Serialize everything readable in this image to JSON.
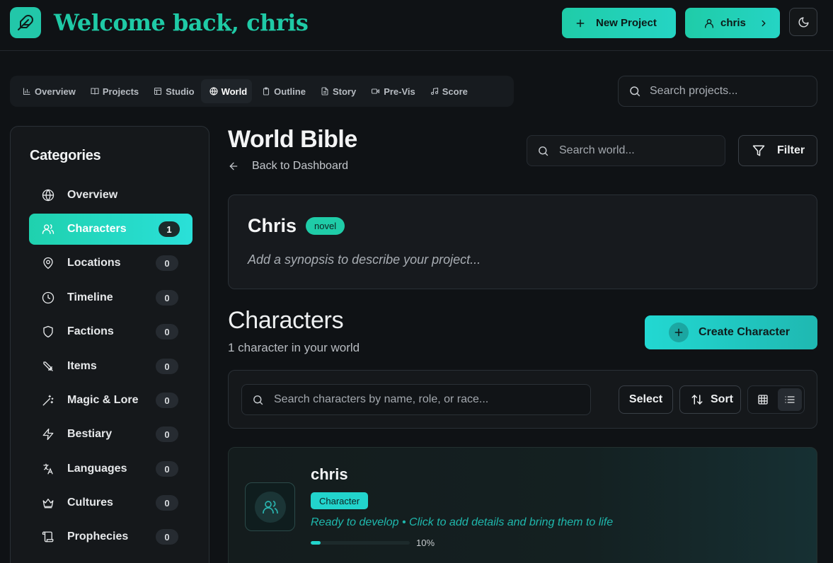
{
  "header": {
    "welcome": "Welcome back, chris",
    "new_project_label": "New Project",
    "user_label": "chris"
  },
  "tabs": [
    {
      "label": "Overview",
      "icon": "bar-chart-icon"
    },
    {
      "label": "Projects",
      "icon": "book-open-icon"
    },
    {
      "label": "Studio",
      "icon": "layout-icon"
    },
    {
      "label": "World",
      "icon": "globe-icon",
      "active": true
    },
    {
      "label": "Outline",
      "icon": "clipboard-icon"
    },
    {
      "label": "Story",
      "icon": "file-text-icon"
    },
    {
      "label": "Pre-Vis",
      "icon": "video-icon"
    },
    {
      "label": "Score",
      "icon": "music-icon"
    }
  ],
  "top_search": {
    "placeholder": "Search projects..."
  },
  "sidebar": {
    "title": "Categories",
    "items": [
      {
        "label": "Overview",
        "icon": "globe-icon"
      },
      {
        "label": "Characters",
        "count": "1",
        "icon": "users-icon",
        "active": true
      },
      {
        "label": "Locations",
        "count": "0",
        "icon": "map-pin-icon"
      },
      {
        "label": "Timeline",
        "count": "0",
        "icon": "clock-icon"
      },
      {
        "label": "Factions",
        "count": "0",
        "icon": "shield-icon"
      },
      {
        "label": "Items",
        "count": "0",
        "icon": "sword-icon"
      },
      {
        "label": "Magic & Lore",
        "count": "0",
        "icon": "magic-wand-icon"
      },
      {
        "label": "Bestiary",
        "count": "0",
        "icon": "zap-icon"
      },
      {
        "label": "Languages",
        "count": "0",
        "icon": "languages-icon"
      },
      {
        "label": "Cultures",
        "count": "0",
        "icon": "crown-icon"
      },
      {
        "label": "Prophecies",
        "count": "0",
        "icon": "scroll-icon"
      }
    ]
  },
  "main": {
    "title": "World Bible",
    "back_label": "Back to Dashboard",
    "search_placeholder": "Search world...",
    "filter_label": "Filter",
    "project": {
      "name": "Chris",
      "type": "novel",
      "synopsis": "Add a synopsis to describe your project..."
    },
    "section_title": "Characters",
    "section_count": "1 character in your world",
    "create_label": "Create Character",
    "toolbar": {
      "search_placeholder": "Search characters by name, role, or race...",
      "select_label": "Select",
      "sort_label": "Sort",
      "view_mode": "list"
    },
    "character": {
      "name": "chris",
      "role": "Character",
      "hint": "Ready to develop • Click to add details and bring them to life",
      "progress": 0.1,
      "progress_label": "10%"
    }
  },
  "colors": {
    "accent": "#1fcca8",
    "accent_cyan": "#22d4cc",
    "background": "#0f1215"
  }
}
